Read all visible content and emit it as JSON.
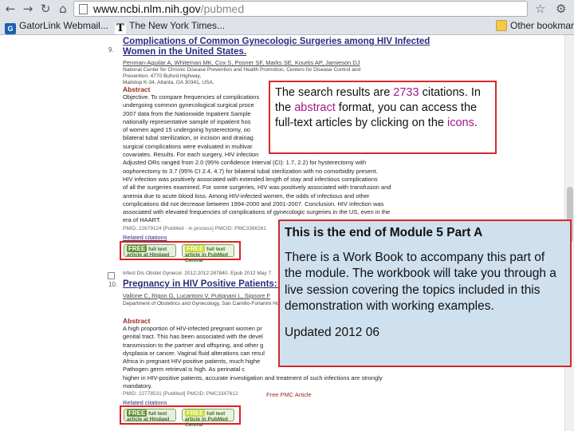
{
  "browser": {
    "url_host": "www.ncbi.nlm.nih.gov",
    "url_path": "/pubmed",
    "bookmarks": [
      "GatorLink Webmail...",
      "The New York Times...",
      "Other bookmarks"
    ]
  },
  "result1": {
    "number": "9.",
    "title_line1": "Complications of Common Gynecologic Surgeries among HIV Infected",
    "title_line2": "Women in the United States.",
    "authors": "Penman-Aguilar A, Whiteman MK, Cox S, Posner SF, Marks SE, Kourtis AP, Jamieson DJ",
    "affil_line1": "National Center for Chronic Disease Prevention and Health Promotion, Centers for Disease Control and Prevention, 4770 Buford Highway,",
    "affil_line2": "Mailstop K-34, Atlanta, GA 30341, USA.",
    "abstract_heading": "Abstract",
    "abstract_lines": [
      "Objective. To compare frequencies of complications",
      "undergoing common gynecological surgical proce",
      "2007 data from the Nationwide Inpatient Sample",
      "nationally representative sample of inpatient hos",
      "of women aged 15 undergoing hysterectomy, oo",
      "bilateral tubal sterilization, or incision and drainag",
      "surgical complications were evaluated in multivar",
      "covariates. Results. For each surgery, HIV infection",
      "Adjusted ORs ranged from 2.0 (95% confidence Interval (CI): 1.7, 2.2) for hysterectomy with",
      "oophorectomy to 3.7 (95% CI 2.4, 4.7) for bilateral tubal sterilization with no comorbidity present.",
      "HIV infection was positively associated with extended length of stay and infectious complications",
      "of all the surgeries examined. For some surgeries, HIV was positively associated with transfusion and",
      "anemia due to acute blood loss. Among HIV-infected women, the odds of infectious and other",
      "complications did not decrease between 1994-2000 and 2001-2007. Conclusion. HIV infection was",
      "associated with elevated frequencies of complications of gynecologic surgeries in the US, even in the",
      "era of HAART."
    ],
    "pmid": "PMID: 22679124 [PubMed - in process]   PMCID: PMC3366261",
    "related": "Related citations",
    "badge_a_top": "FREE",
    "badge_a_rest": "full text article at Hindawi",
    "badge_b_top": "FREE",
    "badge_b_rest": "full text article in PubMed Central"
  },
  "result2": {
    "number": "10.",
    "epub": "Infect Dis Obstet Gynecol. 2012;2012:287840. Epub 2012 May 7.",
    "title": "Pregnancy in HIV Positive Patients: Effe",
    "authors": "Vallone C, Rigon G, Lucantoni V, Putignani L, Signore F",
    "affil": "Department of Obstetrics and Gynecology, San Camillo-Forlanini Hospital",
    "abstract_heading": "Abstract",
    "abstract_lines": [
      "A high proportion of HIV-infected pregnant women pr",
      "genital tract. This has been associated with the devel",
      "transmission to the partner and offspring, and other g",
      "dysplasia or cancer. Vaginal fluid alterations can resul",
      "Africa in pregnant HIV-positive patients, much highe",
      "Pathogen germ retrieval is high. As perinatal c",
      "higher in HIV-positive patients, accurate investigation and treatment of such infections are strongly",
      "mandatory."
    ],
    "pmid": "PMID: 22778531 [PubMed]   PMCID: PMC3347612",
    "related": "Related citations",
    "free_article": "Free PMC Article",
    "badge_a_top": "FREE",
    "badge_a_rest": "full text article at Hindawi",
    "badge_b_top": "FREE",
    "badge_b_rest": "full text article in PubMed Central"
  },
  "callout1": {
    "t1": "The search results are ",
    "count": "2733",
    "t2": " citations.  In the ",
    "abstract_word": "abstract",
    "t3": " format, you can access the full-text articles by clicking on the ",
    "icons_word": "icons",
    "t4": "."
  },
  "callout2": {
    "title": "This is the end of Module 5 Part A",
    "body": "There is a Work Book to accompany this part of the module. The workbook will take you through a live session covering the topics included in this demonstration with working examples.",
    "updated": "Updated 2012 06"
  },
  "colors": {
    "callout_border": "#d42a2a",
    "highlight": "#a01a8a",
    "callout2_bg": "#cfe0ee",
    "title_link": "#2b2e7a"
  }
}
